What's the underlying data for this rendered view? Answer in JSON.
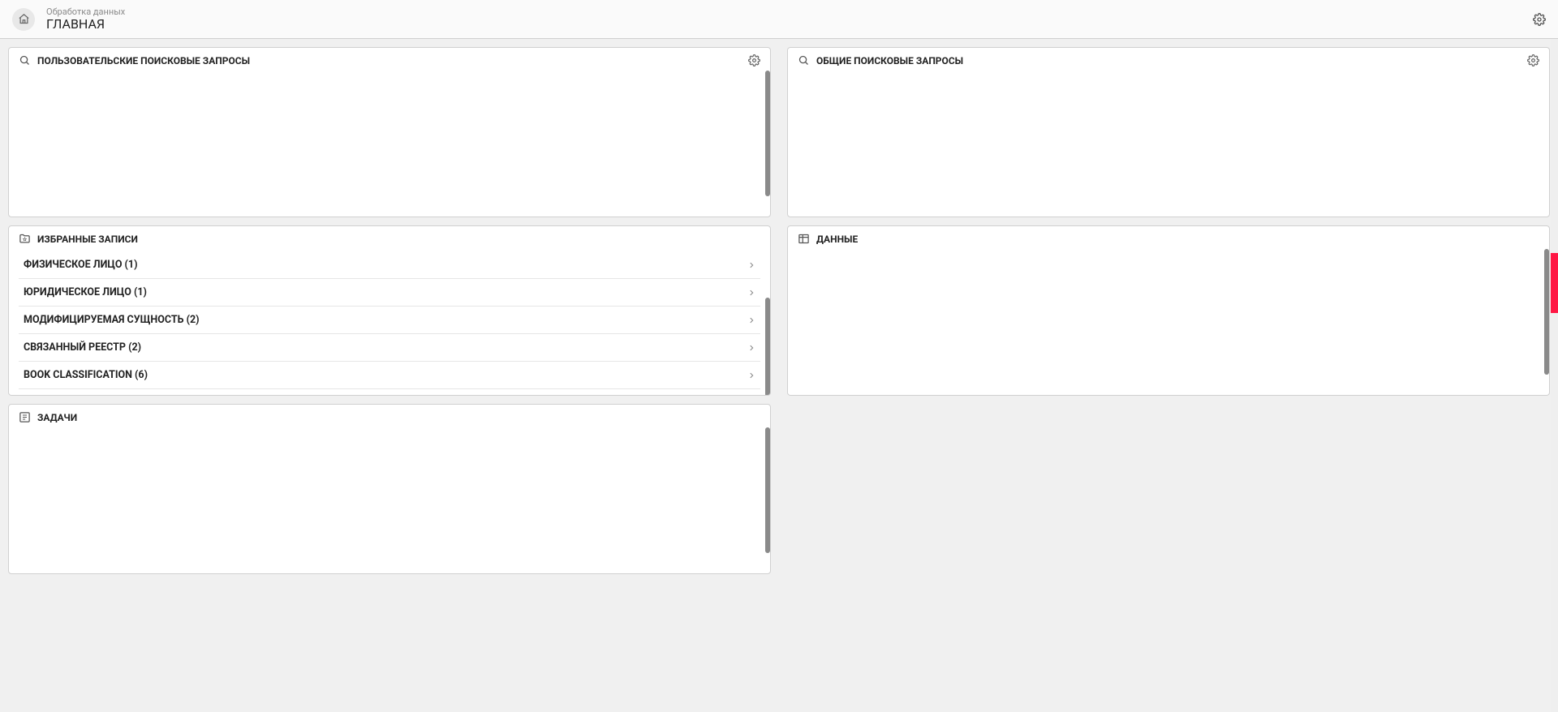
{
  "header": {
    "subtitle": "Обработка данных",
    "title": "ГЛАВНАЯ"
  },
  "panels": {
    "user_searches": {
      "title": "ПОЛЬЗОВАТЕЛЬСКИЕ ПОИСКОВЫЕ ЗАПРОСЫ"
    },
    "common_searches": {
      "title": "ОБЩИЕ ПОИСКОВЫЕ ЗАПРОСЫ"
    },
    "favorites": {
      "title": "ИЗБРАННЫЕ ЗАПИСИ",
      "items": [
        {
          "label": "ФИЗИЧЕСКОЕ ЛИЦО (1)"
        },
        {
          "label": "ЮРИДИЧЕСКОЕ ЛИЦО (1)"
        },
        {
          "label": "МОДИФИЦИРУЕМАЯ СУЩНОСТЬ (2)"
        },
        {
          "label": "СВЯЗАННЫЙ РЕЕСТР (2)"
        },
        {
          "label": "BOOK CLASSIFICATION (6)"
        }
      ]
    },
    "data": {
      "title": "ДАННЫЕ"
    },
    "tasks": {
      "title": "ЗАДАЧИ"
    }
  }
}
